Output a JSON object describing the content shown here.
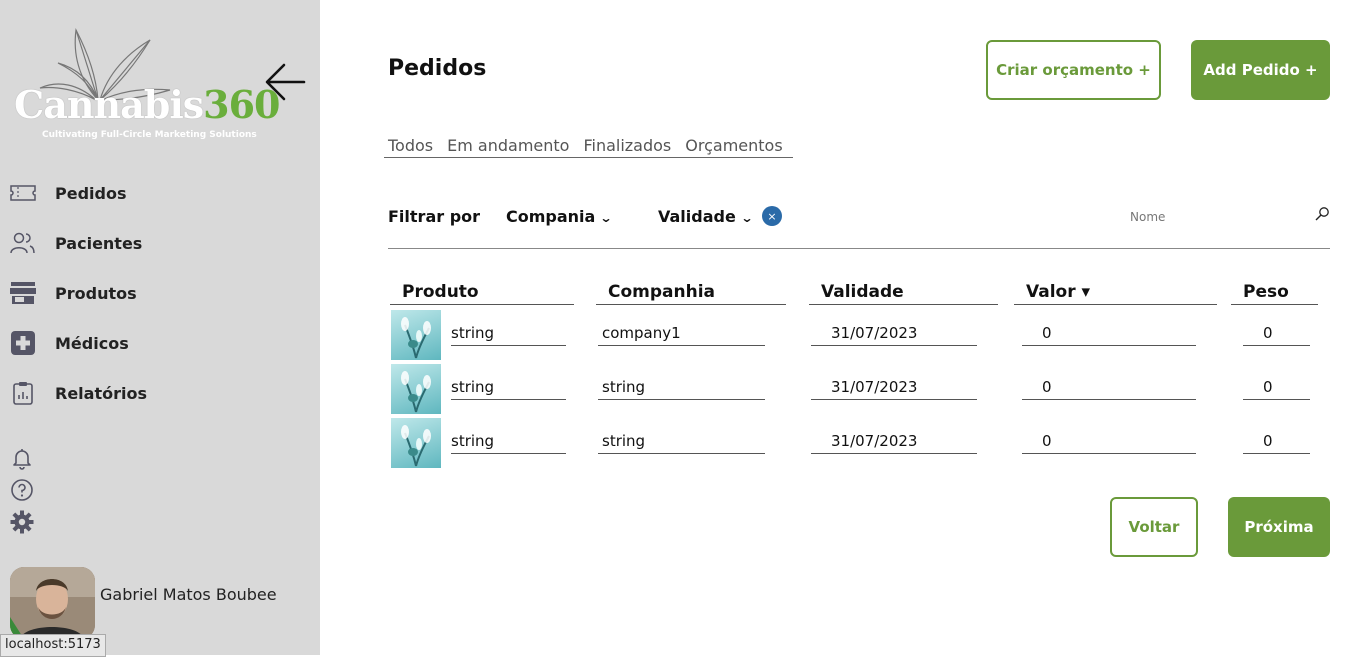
{
  "sidebar": {
    "logo": {
      "word": "Cannabis",
      "number": "360",
      "tagline": "Cultivating Full-Circle Marketing Solutions"
    },
    "nav": [
      {
        "label": "Pedidos",
        "icon": "ticket-icon"
      },
      {
        "label": "Pacientes",
        "icon": "users-icon"
      },
      {
        "label": "Produtos",
        "icon": "store-icon"
      },
      {
        "label": "Médicos",
        "icon": "medical-cross-icon"
      },
      {
        "label": "Relatórios",
        "icon": "clipboard-report-icon"
      }
    ],
    "user": {
      "name": "Gabriel Matos Boubee"
    }
  },
  "status_url": "localhost:5173",
  "header": {
    "title": "Pedidos",
    "btn_quote": "Criar orçamento +",
    "btn_add": "Add Pedido +"
  },
  "tabs": [
    "Todos",
    "Em andamento",
    "Finalizados",
    "Orçamentos"
  ],
  "filters": {
    "label": "Filtrar por",
    "company": "Compania",
    "validity": "Validade",
    "clear": "×",
    "search_placeholder": "Nome"
  },
  "table": {
    "columns": [
      "Produto",
      "Companhia",
      "Validade",
      "Valor ▾",
      "Peso"
    ],
    "rows": [
      {
        "produto": "string",
        "companhia": "company1",
        "validade": "31/07/2023",
        "valor": "0",
        "peso": "0"
      },
      {
        "produto": "string",
        "companhia": "string",
        "validade": "31/07/2023",
        "valor": "0",
        "peso": "0"
      },
      {
        "produto": "string",
        "companhia": "string",
        "validade": "31/07/2023",
        "valor": "0",
        "peso": "0"
      }
    ]
  },
  "pagination": {
    "prev": "Voltar",
    "next": "Próxima"
  },
  "colors": {
    "accent": "#6a9a3a",
    "sidebar": "#d9d9d9",
    "clear": "#2a6aa8"
  }
}
